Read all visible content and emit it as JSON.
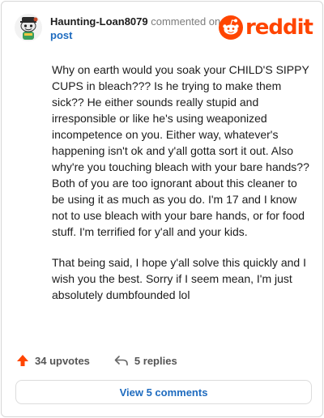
{
  "comment": {
    "username": "Haunting-Loan8079",
    "commented_on": "commented on",
    "post_link": "post",
    "paragraphs": [
      "Why on earth would you soak your CHILD'S SIPPY CUPS in bleach??? Is he trying to make them sick?? He either sounds really stupid and irresponsible or like he's using weaponized incompetence on you. Either way, whatever's happening isn't ok and y'all gotta sort it out. Also why're you touching bleach with your bare hands?? Both of you are too ignorant about this cleaner to be using it as much as you do. I'm 17 and I know not to use bleach with your bare hands, or for food stuff. I'm terrified for y'all and your kids.",
      "That being said, I hope y'all solve this quickly and I wish you the best. Sorry if I seem mean, I'm just absolutely dumbfounded lol"
    ]
  },
  "brand": {
    "logo_text": "reddit",
    "color": "#ff4500"
  },
  "actions": {
    "upvotes": "34 upvotes",
    "replies": "5 replies"
  },
  "view_comments_label": "View 5 comments",
  "colors": {
    "accent": "#ff4500",
    "link": "#1e6bbf"
  }
}
